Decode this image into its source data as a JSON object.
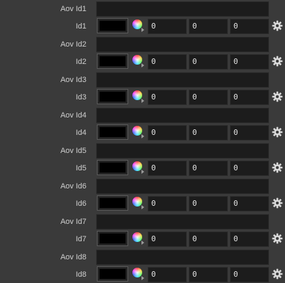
{
  "rows": [
    {
      "aov_label": "Aov Id1",
      "id_label": "Id1",
      "values": [
        "0",
        "0",
        "0"
      ]
    },
    {
      "aov_label": "Aov Id2",
      "id_label": "Id2",
      "values": [
        "0",
        "0",
        "0"
      ]
    },
    {
      "aov_label": "Aov Id3",
      "id_label": "Id3",
      "values": [
        "0",
        "0",
        "0"
      ]
    },
    {
      "aov_label": "Aov Id4",
      "id_label": "Id4",
      "values": [
        "0",
        "0",
        "0"
      ]
    },
    {
      "aov_label": "Aov Id5",
      "id_label": "Id5",
      "values": [
        "0",
        "0",
        "0"
      ]
    },
    {
      "aov_label": "Aov Id6",
      "id_label": "Id6",
      "values": [
        "0",
        "0",
        "0"
      ]
    },
    {
      "aov_label": "Aov Id7",
      "id_label": "Id7",
      "values": [
        "0",
        "0",
        "0"
      ]
    },
    {
      "aov_label": "Aov Id8",
      "id_label": "Id8",
      "values": [
        "0",
        "0",
        "0"
      ]
    }
  ],
  "colors": {
    "swatch": "#000000"
  },
  "icons": {
    "color_picker": "color-wheel-icon",
    "settings": "gear-icon"
  }
}
